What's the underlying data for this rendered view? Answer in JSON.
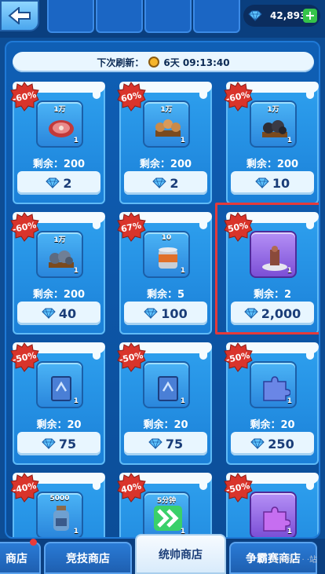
{
  "currency": {
    "icon": "gem-icon",
    "amount": "42,893",
    "plus": "+"
  },
  "refresh": {
    "label": "下次刷新：",
    "time": "6天 09:13:40"
  },
  "items": [
    {
      "discount": "-60%",
      "qty": "1万",
      "count": "1",
      "remaining": "剩余：200",
      "price": "2",
      "art": "meat",
      "frame": "blue"
    },
    {
      "discount": "60%",
      "qty": "1万",
      "count": "1",
      "remaining": "剩余：200",
      "price": "2",
      "art": "wood",
      "frame": "blue"
    },
    {
      "discount": "-60%",
      "qty": "1万",
      "count": "1",
      "remaining": "剩余：200",
      "price": "10",
      "art": "coal",
      "frame": "blue"
    },
    {
      "discount": "-60%",
      "qty": "1万",
      "count": "1",
      "remaining": "剩余：200",
      "price": "40",
      "art": "ore",
      "frame": "blue"
    },
    {
      "discount": "67%",
      "qty": "10",
      "count": "1",
      "remaining": "剩余：5",
      "price": "100",
      "art": "can",
      "frame": "blue"
    },
    {
      "discount": "50%",
      "qty": "",
      "count": "1",
      "remaining": "剩余：2",
      "price": "2,000",
      "art": "statue",
      "frame": "purple"
    },
    {
      "discount": "-50%",
      "qty": "",
      "count": "1",
      "remaining": "剩余：20",
      "price": "75",
      "art": "book",
      "frame": "blue"
    },
    {
      "discount": "-50%",
      "qty": "",
      "count": "1",
      "remaining": "剩余：20",
      "price": "75",
      "art": "book",
      "frame": "blue"
    },
    {
      "discount": "-50%",
      "qty": "",
      "count": "1",
      "remaining": "剩余：20",
      "price": "250",
      "art": "puzzle",
      "frame": "blue"
    },
    {
      "discount": "-40%",
      "qty": "5000",
      "count": "1",
      "remaining": "",
      "price": "",
      "art": "bottle",
      "frame": "blue"
    },
    {
      "discount": "40%",
      "qty": "5分钟",
      "count": "1",
      "remaining": "",
      "price": "",
      "art": "speedup",
      "frame": "blue"
    },
    {
      "discount": "-50%",
      "qty": "",
      "count": "1",
      "remaining": "",
      "price": "",
      "art": "puzzle-purple",
      "frame": "purple"
    }
  ],
  "tabs": [
    {
      "label": "商店",
      "active": false
    },
    {
      "label": "竞技商店",
      "active": false
    },
    {
      "label": "统帅商店",
      "active": true
    },
    {
      "label": "争霸赛商店",
      "active": false
    }
  ],
  "watermark": "公众号 ·  ·  ·站",
  "colors": {
    "accent": "#1b80d8",
    "badge": "#d9342b",
    "highlight": "#e53a3a"
  }
}
